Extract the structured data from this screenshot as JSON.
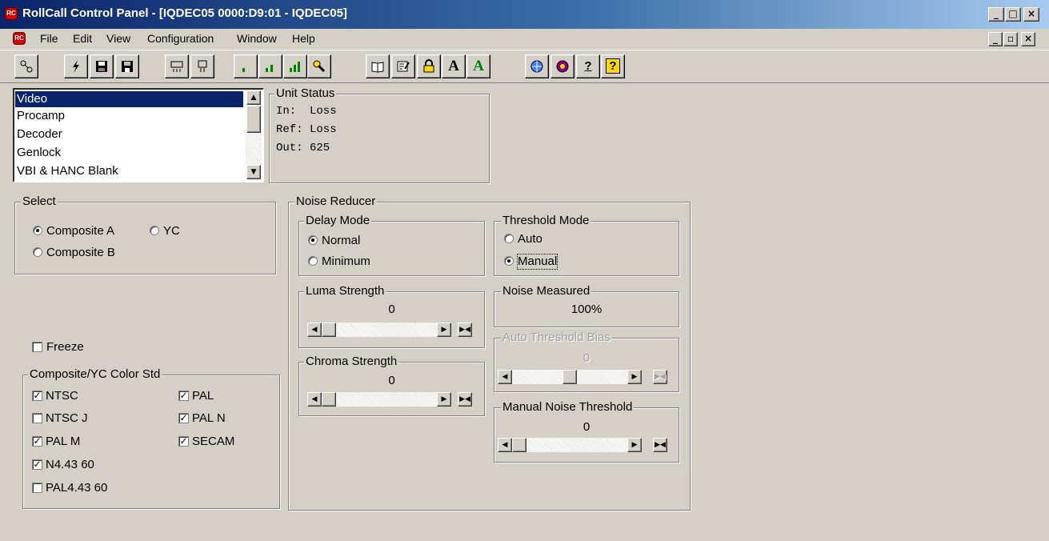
{
  "window": {
    "title": "RollCall Control Panel - [IQDEC05 0000:D9:01 - IQDEC05]",
    "app_icon_text": "Roll Call",
    "title_buttons": [
      "_",
      "□",
      "×"
    ],
    "mdi_buttons": [
      "_",
      "▫",
      "×"
    ]
  },
  "menu": {
    "items": [
      "File",
      "Edit",
      "View",
      "Configuration",
      "Window",
      "Help"
    ]
  },
  "toolbar": {
    "buttons": [
      {
        "icon": "network-icon"
      },
      {
        "icon": "lightning-icon"
      },
      {
        "icon": "save-copy-icon"
      },
      {
        "icon": "save-disk-icon"
      },
      {
        "icon": "layout-a-icon"
      },
      {
        "icon": "layout-b-icon"
      },
      {
        "icon": "signal-low-icon"
      },
      {
        "icon": "signal-mid-icon"
      },
      {
        "icon": "signal-high-icon"
      },
      {
        "icon": "wrench-icon"
      },
      {
        "icon": "book-icon"
      },
      {
        "icon": "edit-form-icon"
      },
      {
        "icon": "lock-icon"
      },
      {
        "icon": "font-a-icon",
        "text": "A"
      },
      {
        "icon": "font-a-green-icon",
        "text": "A"
      },
      {
        "icon": "globe-icon"
      },
      {
        "icon": "logo-icon"
      },
      {
        "icon": "help-index-icon",
        "text": "?"
      },
      {
        "icon": "help-icon",
        "text": "?"
      }
    ]
  },
  "pages_list": {
    "items": [
      "Video",
      "Procamp",
      "Decoder",
      "Genlock",
      "VBI & HANC Blank"
    ],
    "selected_index": 0
  },
  "unit_status": {
    "title": "Unit Status",
    "lines": [
      "In:  Loss",
      "Ref: Loss",
      "Out: 625"
    ]
  },
  "select": {
    "title": "Select",
    "composite_a": "Composite A",
    "yc": "YC",
    "composite_b": "Composite B",
    "selected": "Composite A"
  },
  "freeze": {
    "label": "Freeze",
    "checked": false
  },
  "color_std": {
    "title": "Composite/YC Color Std",
    "left": [
      {
        "label": "NTSC",
        "checked": true
      },
      {
        "label": "NTSC J",
        "checked": false
      },
      {
        "label": "PAL M",
        "checked": true
      },
      {
        "label": "N4.43 60",
        "checked": true
      },
      {
        "label": "PAL4.43 60",
        "checked": false
      }
    ],
    "right": [
      {
        "label": "PAL",
        "checked": true
      },
      {
        "label": "PAL N",
        "checked": true
      },
      {
        "label": "SECAM",
        "checked": true
      }
    ]
  },
  "noise_reducer": {
    "title": "Noise Reducer",
    "delay_mode": {
      "title": "Delay Mode",
      "normal": "Normal",
      "minimum": "Minimum",
      "selected": "Normal"
    },
    "threshold_mode": {
      "title": "Threshold Mode",
      "auto": "Auto",
      "manual": "Manual",
      "selected": "Manual"
    },
    "luma_strength": {
      "title": "Luma Strength",
      "value": "0",
      "slider_fraction": 0.0
    },
    "noise_measured": {
      "title": "Noise Measured",
      "value": "100%"
    },
    "auto_threshold_bias": {
      "title": "Auto Threshold Bias",
      "value": "0",
      "slider_fraction": 0.5,
      "enabled": false
    },
    "chroma_strength": {
      "title": "Chroma Strength",
      "value": "0",
      "slider_fraction": 0.0
    },
    "manual_noise_threshold": {
      "title": "Manual Noise Threshold",
      "value": "0",
      "slider_fraction": 0.0
    }
  },
  "colors": {
    "title_start": "#0a246a",
    "title_end": "#a6caf0",
    "selection": "#0a246a",
    "face": "#d4d0c8"
  }
}
